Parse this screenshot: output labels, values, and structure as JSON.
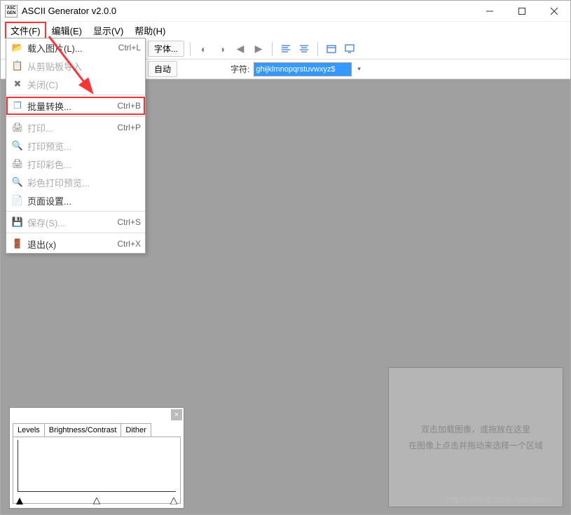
{
  "window": {
    "title": "ASCII Generator v2.0.0",
    "icon_text": "ASC GEN"
  },
  "menubar": {
    "file": "文件(F)",
    "edit": "编辑(E)",
    "view": "显示(V)",
    "help": "帮助(H)"
  },
  "toolbar": {
    "font_button": "字体..."
  },
  "secondary_toolbar": {
    "auto_button": "自动",
    "chars_label": "字符:",
    "chars_value": "ghijklmnopqrstuvwxyz$"
  },
  "file_menu": {
    "load_image": "载入图片(L)...",
    "load_image_sc": "Ctrl+L",
    "from_clipboard": "从剪贴板导入",
    "close": "关闭(C)",
    "batch_convert": "批量转换...",
    "batch_convert_sc": "Ctrl+B",
    "print": "打印...",
    "print_sc": "Ctrl+P",
    "print_preview": "打印预览...",
    "print_color": "打印彩色...",
    "color_print_preview": "彩色打印预览...",
    "page_setup": "页面设置...",
    "save": "保存(S)...",
    "save_sc": "Ctrl+S",
    "exit": "退出(x)",
    "exit_sc": "Ctrl+X"
  },
  "levels_panel": {
    "tab_levels": "Levels",
    "tab_brightness": "Brightness/Contrast",
    "tab_dither": "Dither"
  },
  "drop_panel": {
    "line1": "双击加载图像，或拖放在这里",
    "line2": "在图像上点击并拖动来选择一个区域"
  },
  "watermark": "https://blog.csdn.net/stalin_"
}
